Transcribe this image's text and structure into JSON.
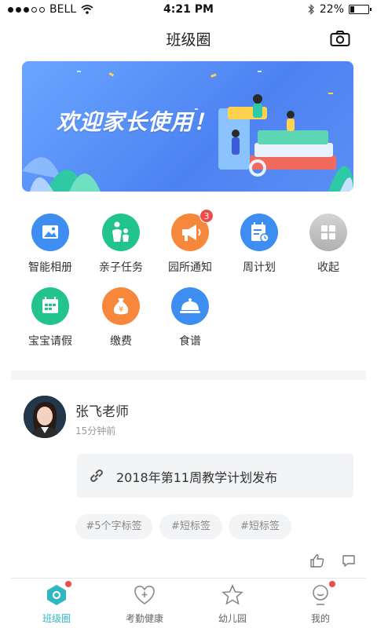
{
  "status_bar": {
    "carrier": "BELL",
    "time": "4:21 PM",
    "battery": "22%",
    "battery_level": 0.22
  },
  "nav": {
    "title": "班级圈",
    "camera_icon": "camera-icon"
  },
  "banner": {
    "text": "欢迎家长使用！"
  },
  "grid": [
    {
      "label": "智能相册",
      "icon": "photo-album-icon",
      "color": "#3d8ef0"
    },
    {
      "label": "亲子任务",
      "icon": "parent-child-icon",
      "color": "#22c38e"
    },
    {
      "label": "园所通知",
      "icon": "megaphone-icon",
      "color": "#f7873b",
      "badge": "3"
    },
    {
      "label": "周计划",
      "icon": "calendar-plan-icon",
      "color": "#3d8ef0"
    },
    {
      "label": "收起",
      "icon": "collapse-grid-icon",
      "color": "#bdbdbd"
    },
    {
      "label": "宝宝请假",
      "icon": "leave-calendar-icon",
      "color": "#22c38e"
    },
    {
      "label": "缴费",
      "icon": "money-bag-icon",
      "color": "#f7873b"
    },
    {
      "label": "食谱",
      "icon": "food-cloche-icon",
      "color": "#3d8ef0"
    }
  ],
  "post": {
    "author": "张飞老师",
    "time": "15分钟前",
    "link_text": "2018年第11周教学计划发布",
    "tags": [
      "#5个字标签",
      "#短标签",
      "#短标签"
    ]
  },
  "tabbar": [
    {
      "label": "班级圈",
      "icon": "class-circle-icon",
      "active": true,
      "dot": true
    },
    {
      "label": "考勤健康",
      "icon": "heart-health-icon",
      "active": false,
      "dot": false
    },
    {
      "label": "幼儿园",
      "icon": "star-kindergarten-icon",
      "active": false,
      "dot": false
    },
    {
      "label": "我的",
      "icon": "profile-icon",
      "active": false,
      "dot": true
    }
  ]
}
